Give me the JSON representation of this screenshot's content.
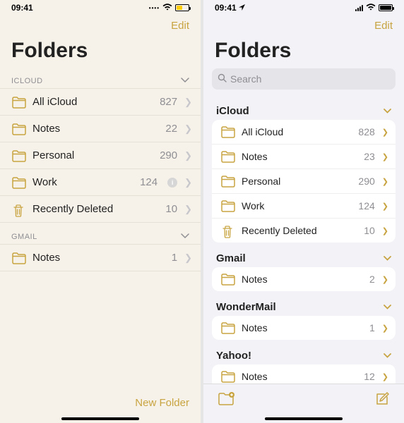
{
  "accent": "#c8a441",
  "left": {
    "time": "09:41",
    "edit": "Edit",
    "title": "Folders",
    "sections": [
      {
        "name": "ICLOUD",
        "folders": [
          {
            "icon": "folder",
            "label": "All iCloud",
            "count": 827
          },
          {
            "icon": "folder",
            "label": "Notes",
            "count": 22
          },
          {
            "icon": "folder",
            "label": "Personal",
            "count": 290
          },
          {
            "icon": "folder",
            "label": "Work",
            "count": 124,
            "info": true
          },
          {
            "icon": "trash",
            "label": "Recently Deleted",
            "count": 10
          }
        ]
      },
      {
        "name": "GMAIL",
        "folders": [
          {
            "icon": "folder",
            "label": "Notes",
            "count": 1
          }
        ]
      }
    ],
    "new_folder": "New Folder"
  },
  "right": {
    "time": "09:41",
    "edit": "Edit",
    "title": "Folders",
    "search_placeholder": "Search",
    "sections": [
      {
        "name": "iCloud",
        "folders": [
          {
            "icon": "folder",
            "label": "All iCloud",
            "count": 828
          },
          {
            "icon": "folder",
            "label": "Notes",
            "count": 23
          },
          {
            "icon": "folder",
            "label": "Personal",
            "count": 290
          },
          {
            "icon": "folder",
            "label": "Work",
            "count": 124
          },
          {
            "icon": "trash",
            "label": "Recently Deleted",
            "count": 10
          }
        ]
      },
      {
        "name": "Gmail",
        "folders": [
          {
            "icon": "folder",
            "label": "Notes",
            "count": 2
          }
        ]
      },
      {
        "name": "WonderMail",
        "folders": [
          {
            "icon": "folder",
            "label": "Notes",
            "count": 1
          }
        ]
      },
      {
        "name": "Yahoo!",
        "folders": [
          {
            "icon": "folder",
            "label": "Notes",
            "count": 12
          }
        ]
      }
    ]
  }
}
